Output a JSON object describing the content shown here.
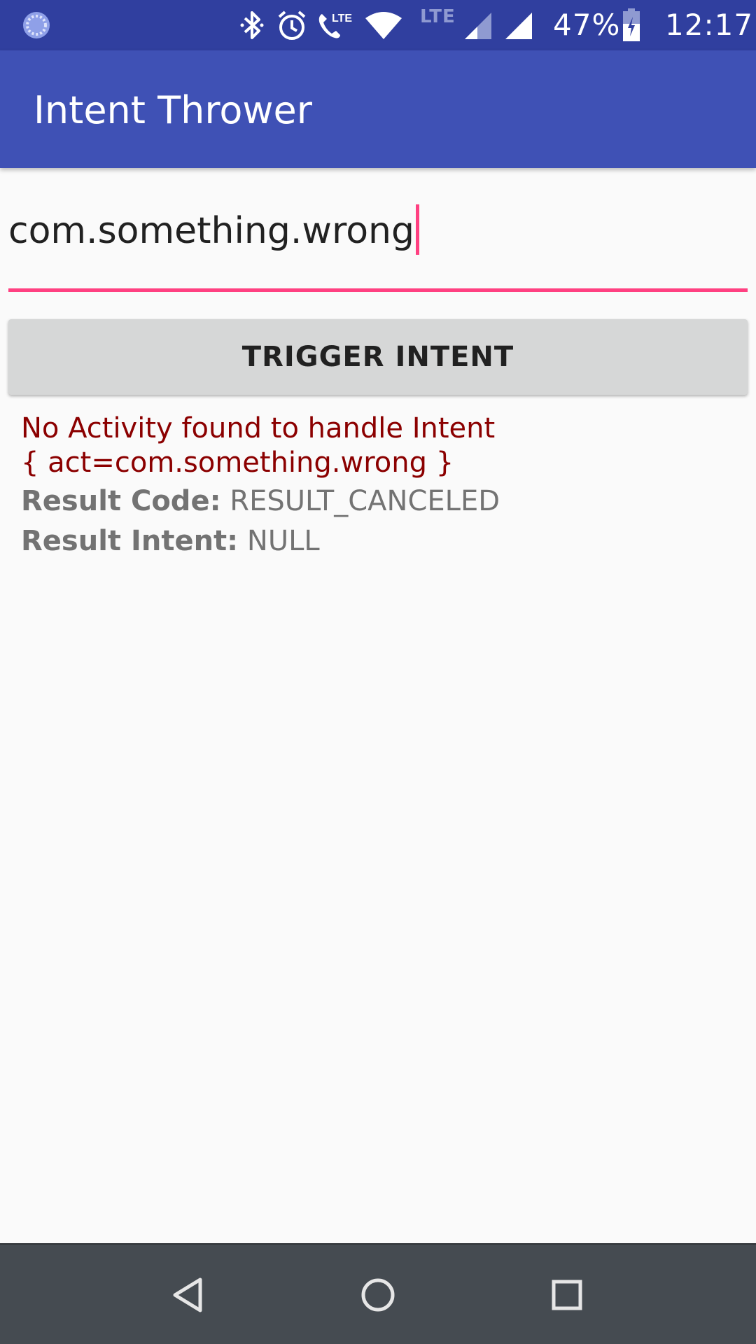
{
  "status_bar": {
    "battery_percent": "47%",
    "time": "12:17",
    "lte_label": "LTE",
    "icons": [
      "app-notification-icon",
      "bluetooth-icon",
      "alarm-icon",
      "volte-call-icon",
      "wifi-icon",
      "lte-signal-icon",
      "signal-icon",
      "battery-charging-icon"
    ]
  },
  "app_bar": {
    "title": "Intent Thrower"
  },
  "input": {
    "value": "com.something.wrong",
    "accent_color": "#ff4081"
  },
  "button": {
    "label": "TRIGGER INTENT"
  },
  "result": {
    "error_line1": "No Activity found to handle Intent",
    "error_line2": "{ act=com.something.wrong }",
    "code_label": "Result Code:",
    "code_value": " RESULT_CANCELED",
    "intent_label": "Result Intent:",
    "intent_value": " NULL"
  },
  "nav_bar": {
    "buttons": [
      "back-icon",
      "home-icon",
      "recents-icon"
    ]
  },
  "colors": {
    "status_bar": "#303f9f",
    "app_bar": "#3f51b5",
    "error": "#8b0000",
    "button": "#d6d7d7",
    "nav_bar": "#454b51"
  }
}
